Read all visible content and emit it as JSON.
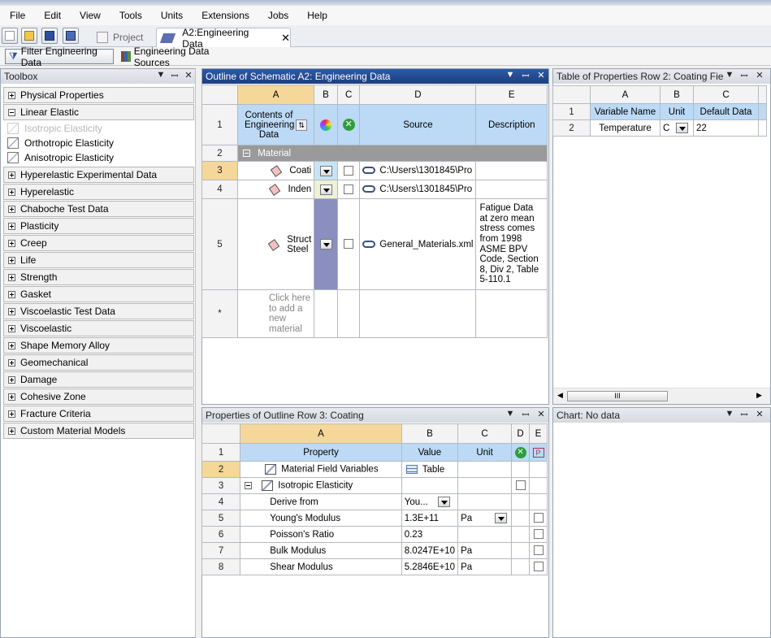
{
  "menu": [
    "File",
    "Edit",
    "View",
    "Tools",
    "Units",
    "Extensions",
    "Jobs",
    "Help"
  ],
  "tabs": {
    "project": "Project",
    "engineering": "A2:Engineering Data"
  },
  "filterbar": {
    "filter": "Filter Engineering Data",
    "sources": "Engineering Data Sources"
  },
  "toolbox": {
    "title": "Toolbox",
    "categories_top": [
      "Physical Properties",
      "Linear Elastic"
    ],
    "linear_elastic_items": [
      "Isotropic Elasticity",
      "Orthotropic Elasticity",
      "Anisotropic Elasticity"
    ],
    "categories": [
      "Hyperelastic Experimental Data",
      "Hyperelastic",
      "Chaboche Test Data",
      "Plasticity",
      "Creep",
      "Life",
      "Strength",
      "Gasket",
      "Viscoelastic Test Data",
      "Viscoelastic",
      "Shape Memory Alloy",
      "Geomechanical",
      "Damage",
      "Cohesive Zone",
      "Fracture Criteria",
      "Custom Material Models"
    ]
  },
  "outline": {
    "title": "Outline of Schematic A2: Engineering Data",
    "cols": [
      "A",
      "B",
      "C",
      "D",
      "E"
    ],
    "header": {
      "contents": "Contents of Engineering Data",
      "source": "Source",
      "description": "Description"
    },
    "group": "Material",
    "rows": [
      {
        "num": "3",
        "name": "Coati",
        "source": "C:\\Users\\1301845\\Pro",
        "desc": ""
      },
      {
        "num": "4",
        "name": "Inden",
        "source": "C:\\Users\\1301845\\Pro",
        "desc": ""
      },
      {
        "num": "5",
        "name": "Struct Steel",
        "source": "General_Materials.xml",
        "desc": "Fatigue Data at zero mean stress comes from 1998 ASME BPV Code, Section 8, Div 2, Table 5-110.1"
      }
    ],
    "add_row": {
      "num": "*",
      "text": "Click here to add a new material"
    },
    "row_nums": [
      "1",
      "2"
    ]
  },
  "table_props": {
    "title": "Table of Properties Row 2: Coating Fie",
    "cols": [
      "A",
      "B",
      "C"
    ],
    "header": [
      "Variable Name",
      "Unit",
      "Default Data"
    ],
    "row": {
      "name": "Temperature",
      "unit": "C",
      "value": "22"
    },
    "row_nums": [
      "1",
      "2"
    ]
  },
  "props": {
    "title": "Properties of Outline Row 3: Coating",
    "cols": [
      "A",
      "B",
      "C",
      "D",
      "E"
    ],
    "header": {
      "property": "Property",
      "value": "Value",
      "unit": "Unit"
    },
    "rows": [
      {
        "num": "2",
        "name": "Material Field Variables",
        "value": "Table",
        "unit": ""
      },
      {
        "num": "3",
        "name": "Isotropic Elasticity",
        "value": "",
        "unit": ""
      },
      {
        "num": "4",
        "name": "Derive from",
        "value": "You...",
        "unit": ""
      },
      {
        "num": "5",
        "name": "Young's Modulus",
        "value": "1.3E+11",
        "unit": "Pa"
      },
      {
        "num": "6",
        "name": "Poisson's Ratio",
        "value": "0.23",
        "unit": ""
      },
      {
        "num": "7",
        "name": "Bulk Modulus",
        "value": "8.0247E+10",
        "unit": "Pa"
      },
      {
        "num": "8",
        "name": "Shear Modulus",
        "value": "5.2846E+10",
        "unit": "Pa"
      }
    ]
  },
  "chart": {
    "title": "Chart: No data"
  },
  "scroll_grip": "III"
}
